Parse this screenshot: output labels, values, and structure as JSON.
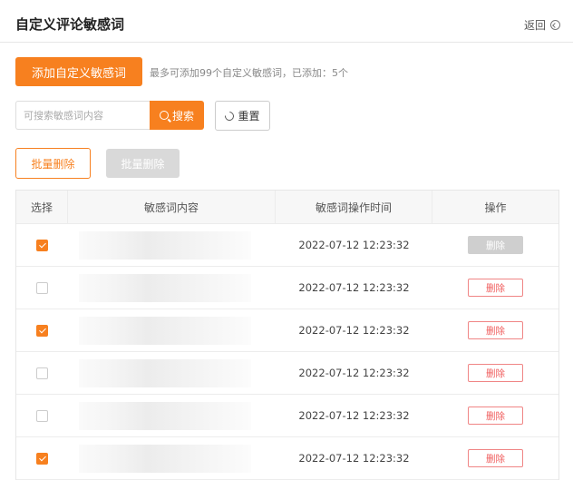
{
  "header": {
    "title": "自定义评论敏感词",
    "back_label": "返回"
  },
  "toolbar": {
    "add_label": "添加自定义敏感词",
    "limit_note": "最多可添加99个自定义敏感词，已添加：5个",
    "search_placeholder": "可搜索敏感词内容",
    "search_label": "搜索",
    "reset_label": "重置",
    "batch_delete_label": "批量删除",
    "batch_delete_disabled_label": "批量删除"
  },
  "table": {
    "columns": [
      "选择",
      "敏感词内容",
      "敏感词操作时间",
      "操作"
    ],
    "rows": [
      {
        "checked": true,
        "content": "",
        "time": "2022-07-12  12:23:32",
        "action": "删除",
        "action_disabled": true
      },
      {
        "checked": false,
        "content": "",
        "time": "2022-07-12  12:23:32",
        "action": "删除",
        "action_disabled": false
      },
      {
        "checked": true,
        "content": "",
        "time": "2022-07-12  12:23:32",
        "action": "删除",
        "action_disabled": false
      },
      {
        "checked": false,
        "content": "",
        "time": "2022-07-12  12:23:32",
        "action": "删除",
        "action_disabled": false
      },
      {
        "checked": false,
        "content": "",
        "time": "2022-07-12  12:23:32",
        "action": "删除",
        "action_disabled": false
      },
      {
        "checked": true,
        "content": "",
        "time": "2022-07-12  12:23:32",
        "action": "删除",
        "action_disabled": false
      }
    ]
  },
  "colors": {
    "accent": "#f7801f",
    "danger": "#f05d5d",
    "disabled": "#d9d9d9"
  },
  "icons": {
    "back": "back-circle-icon",
    "search": "search-icon",
    "reset": "refresh-icon",
    "checkbox": "checkbox-icon"
  }
}
